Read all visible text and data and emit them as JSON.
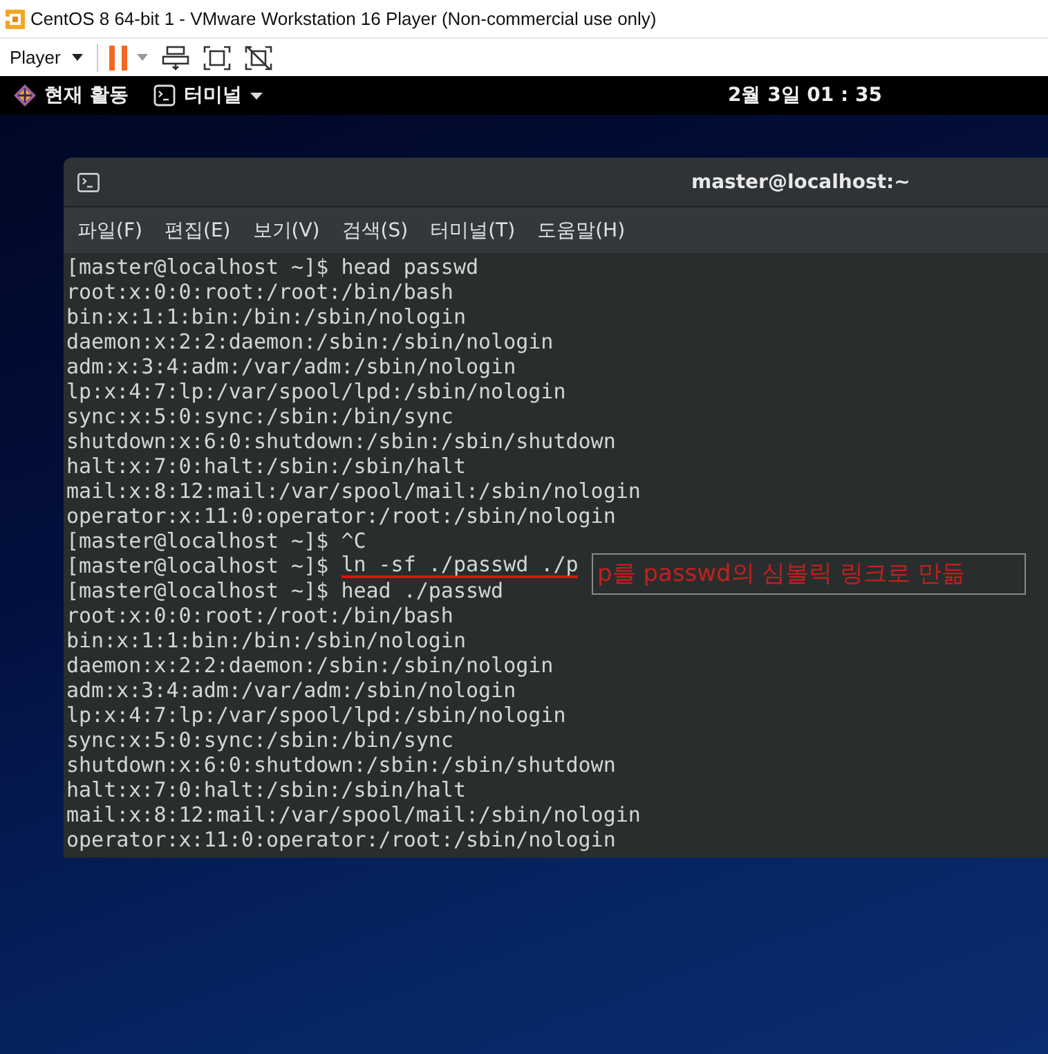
{
  "window": {
    "title": "CentOS 8 64-bit 1 - VMware Workstation 16 Player (Non-commercial use only)"
  },
  "toolbar": {
    "player_menu": "Player"
  },
  "top_bar": {
    "activities": "현재 활동",
    "app_menu": "터미널",
    "clock": "2월 3일 01 : 35"
  },
  "terminal": {
    "title": "master@localhost:~",
    "menu": [
      "파일(F)",
      "편집(E)",
      "보기(V)",
      "검색(S)",
      "터미널(T)",
      "도움말(H)"
    ],
    "lines": [
      {
        "kind": "prompt",
        "prompt": "[master@localhost ~]$ ",
        "command": "head passwd"
      },
      {
        "kind": "output",
        "text": "root:x:0:0:root:/root:/bin/bash"
      },
      {
        "kind": "output",
        "text": "bin:x:1:1:bin:/bin:/sbin/nologin"
      },
      {
        "kind": "output",
        "text": "daemon:x:2:2:daemon:/sbin:/sbin/nologin"
      },
      {
        "kind": "output",
        "text": "adm:x:3:4:adm:/var/adm:/sbin/nologin"
      },
      {
        "kind": "output",
        "text": "lp:x:4:7:lp:/var/spool/lpd:/sbin/nologin"
      },
      {
        "kind": "output",
        "text": "sync:x:5:0:sync:/sbin:/bin/sync"
      },
      {
        "kind": "output",
        "text": "shutdown:x:6:0:shutdown:/sbin:/sbin/shutdown"
      },
      {
        "kind": "output",
        "text": "halt:x:7:0:halt:/sbin:/sbin/halt"
      },
      {
        "kind": "output",
        "text": "mail:x:8:12:mail:/var/spool/mail:/sbin/nologin"
      },
      {
        "kind": "output",
        "text": "operator:x:11:0:operator:/root:/sbin/nologin"
      },
      {
        "kind": "prompt",
        "prompt": "[master@localhost ~]$ ",
        "command": "^C"
      },
      {
        "kind": "prompt",
        "prompt": "[master@localhost ~]$ ",
        "command": "ln -sf ./passwd ./p",
        "underlined": true,
        "note": "p를 passwd의 심볼릭 링크로 만듦"
      },
      {
        "kind": "prompt",
        "prompt": "[master@localhost ~]$ ",
        "command": "head ./passwd"
      },
      {
        "kind": "output",
        "text": "root:x:0:0:root:/root:/bin/bash"
      },
      {
        "kind": "output",
        "text": "bin:x:1:1:bin:/bin:/sbin/nologin"
      },
      {
        "kind": "output",
        "text": "daemon:x:2:2:daemon:/sbin:/sbin/nologin"
      },
      {
        "kind": "output",
        "text": "adm:x:3:4:adm:/var/adm:/sbin/nologin"
      },
      {
        "kind": "output",
        "text": "lp:x:4:7:lp:/var/spool/lpd:/sbin/nologin"
      },
      {
        "kind": "output",
        "text": "sync:x:5:0:sync:/sbin:/bin/sync"
      },
      {
        "kind": "output",
        "text": "shutdown:x:6:0:shutdown:/sbin:/sbin/shutdown"
      },
      {
        "kind": "output",
        "text": "halt:x:7:0:halt:/sbin:/sbin/halt"
      },
      {
        "kind": "output",
        "text": "mail:x:8:12:mail:/var/spool/mail:/sbin/nologin"
      },
      {
        "kind": "output",
        "text": "operator:x:11:0:operator:/root:/sbin/nologin"
      }
    ]
  }
}
